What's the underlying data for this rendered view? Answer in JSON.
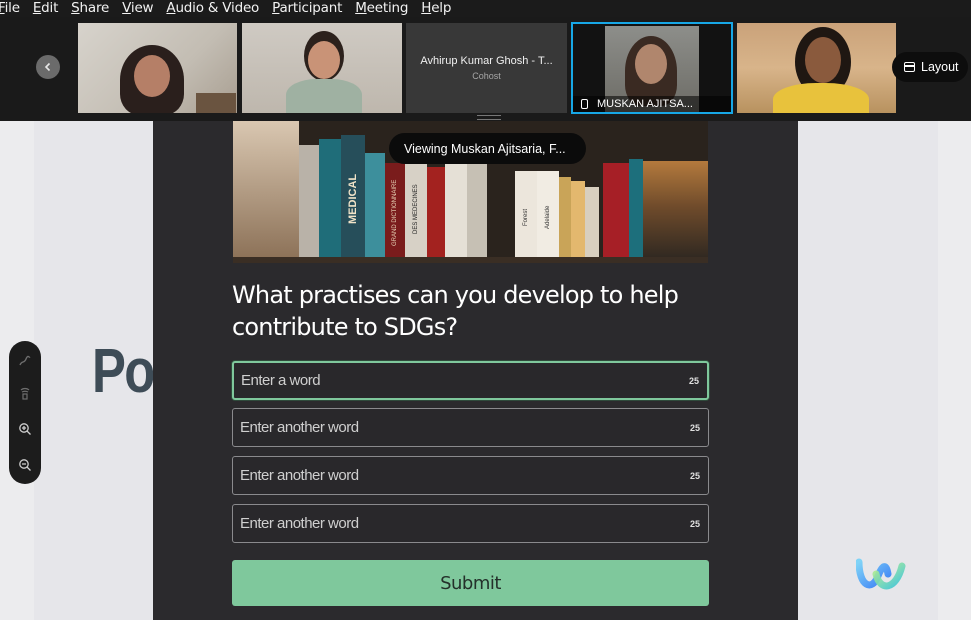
{
  "menubar": {
    "items": [
      {
        "label": "File",
        "mnemonic": "F",
        "rest": "ile"
      },
      {
        "label": "Edit",
        "mnemonic": "E",
        "rest": "dit"
      },
      {
        "label": "Share",
        "mnemonic": "S",
        "rest": "hare"
      },
      {
        "label": "View",
        "mnemonic": "V",
        "rest": "iew"
      },
      {
        "label": "Audio & Video",
        "mnemonic": "A",
        "rest": "udio & Video"
      },
      {
        "label": "Participant",
        "mnemonic": "P",
        "rest": "articipant"
      },
      {
        "label": "Meeting",
        "mnemonic": "M",
        "rest": "eeting"
      },
      {
        "label": "Help",
        "mnemonic": "H",
        "rest": "elp"
      }
    ]
  },
  "participants": {
    "cohost": {
      "name": "Avhirup Kumar Ghosh - T...",
      "role": "Cohost"
    },
    "active": {
      "name": "MUSKAN AJITSA..."
    },
    "active_border_color": "#17a7e6"
  },
  "layout_button": {
    "label": "Layout"
  },
  "viewing_banner": {
    "text": "Viewing Muskan Ajitsaria, F..."
  },
  "slide": {
    "title_fragment": "Po"
  },
  "poll": {
    "question": "What practises can you develop to help contribute to SDGs?",
    "fields": [
      {
        "placeholder": "Enter a word",
        "count": "25"
      },
      {
        "placeholder": "Enter another word",
        "count": "25"
      },
      {
        "placeholder": "Enter another word",
        "count": "25"
      },
      {
        "placeholder": "Enter another word",
        "count": "25"
      }
    ],
    "submit_label": "Submit",
    "accent_color": "#7fc89c"
  },
  "shelf_spines": [
    "MEDICAL",
    "GRAND DICTIONNAIRE",
    "DES MEDECINES",
    "Forest",
    "Adelaide"
  ],
  "annotation_toolbar": {
    "icons": [
      "pen-icon",
      "eraser-icon",
      "zoom-in-icon",
      "zoom-out-icon"
    ]
  }
}
